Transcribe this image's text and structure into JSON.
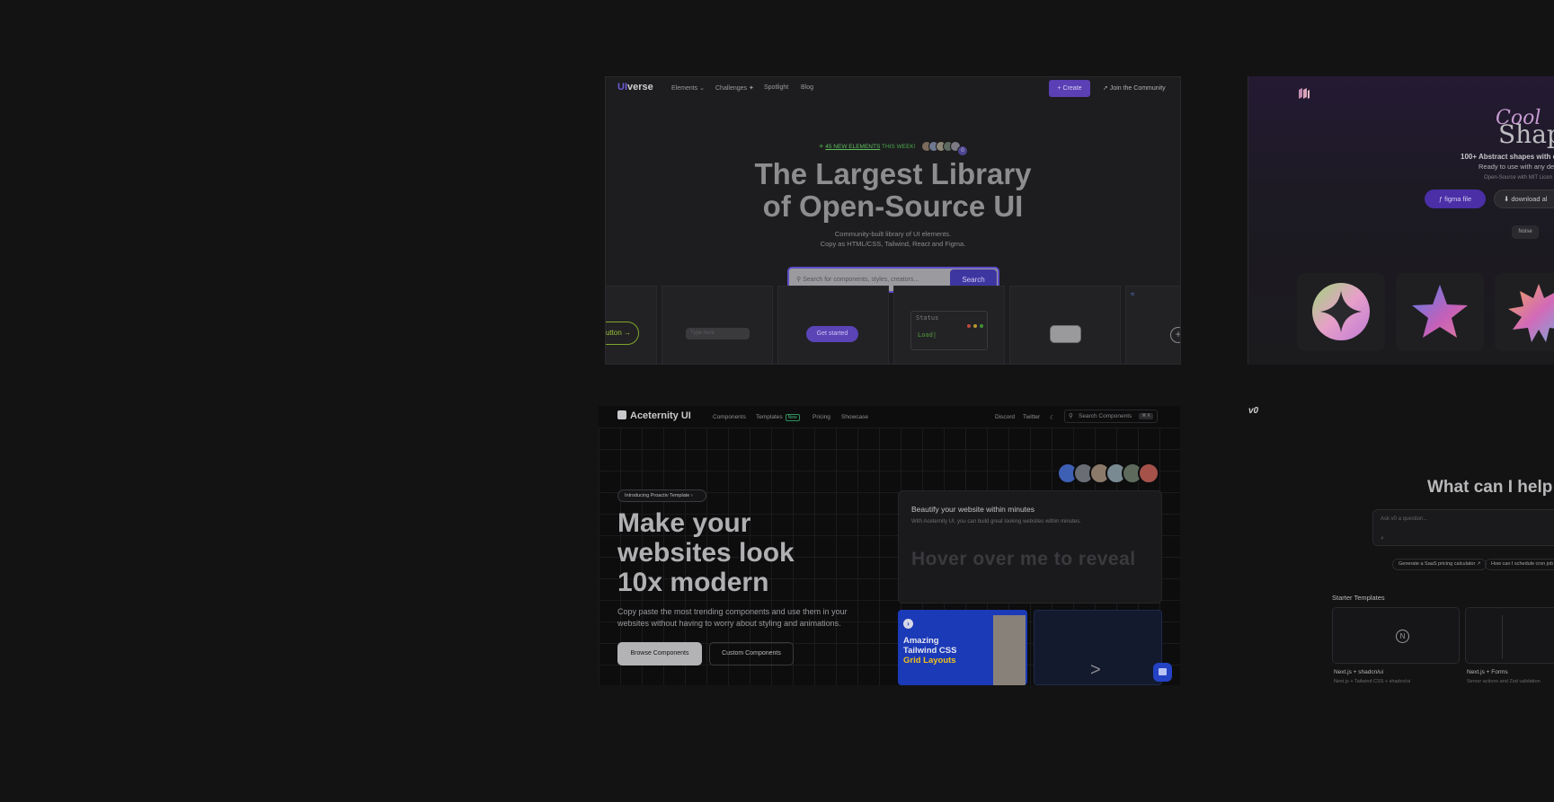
{
  "uiverse": {
    "logo_ui": "UI",
    "logo_verse": "verse",
    "nav": [
      "Elements",
      "Challenges",
      "Spotlight",
      "Blog"
    ],
    "nav_elements": "Elements ⌄",
    "nav_challenges": "Challenges ✦",
    "nav_spotlight": "Spotlight",
    "nav_blog": "Blog",
    "create": "+  Create",
    "join": "Join the Community",
    "new_count": "45 NEW ELEMENTS",
    "new_suffix": " THIS WEEK!",
    "avatar_badge": "0",
    "title_line1": "The Largest Library",
    "title_line2": "of Open-Source UI",
    "sub_line1": "Community-built library of UI elements.",
    "sub_line2": "Copy as HTML/CSS, Tailwind, React and Figma.",
    "search_placeholder": "Search for components, styles, creators...",
    "search_button": "Search",
    "tile_button": "utton  →",
    "tile_input": "Type here",
    "tile_get_started": "Get started",
    "tile_terminal_title": "Status",
    "tile_terminal_text": "Load|",
    "tile_plus": "+"
  },
  "shapes": {
    "cool": "Cool",
    "shapes": "Shap",
    "line1": "100+ Abstract shapes with co",
    "line2": "Ready to use with any des",
    "line3": "Open-Source with MIT Licen",
    "figma_button": "figma file",
    "download_button": "download al",
    "noise_tab": "Noise"
  },
  "aceternity": {
    "logo": "Aceternity UI",
    "nav_components": "Components",
    "nav_templates": "Templates",
    "nav_new_badge": "New",
    "nav_pricing": "Pricing",
    "nav_showcase": "Showcase",
    "nav_discord": "Discord",
    "nav_twitter": "Twitter",
    "search": "Search Components",
    "search_kbd": "⌘ K",
    "intro": "Introducing Proactiv Template",
    "hero_line1": "Make your",
    "hero_line2": "websites look",
    "hero_line3": "10x modern",
    "desc": "Copy paste the most trending components and use them in your websites without having to worry about styling and animations.",
    "browse": "Browse Components",
    "custom": "Custom Components",
    "panel_title": "Beautify your website within minutes",
    "panel_sub": "With Aceternity UI, you can build great looking websites within minutes.",
    "panel_reveal": "Hover over me to reveal",
    "blue_line1": "Amazing",
    "blue_line2": "Tailwind CSS",
    "blue_line3": "Grid Layouts",
    "map_arrow": ">"
  },
  "v0": {
    "logo": "v0",
    "heading": "What can I help",
    "ask_placeholder": "Ask v0 a question...",
    "chip1": "Generate a SaaS pricing calculator ↗",
    "chip2": "How can I schedule cron job",
    "starter": "Starter Templates",
    "tile1_label": "Next.js + shadcn/ui",
    "tile1_sub": "Next.js + Tailwind CSS + shadcn/ui",
    "tile2_label": "Next.js + Forms",
    "tile2_sub": "Server actions and Zod validation"
  },
  "colors": {
    "page_bg": "#131314",
    "uiverse_accent": "#5b3fb4",
    "aceternity_blue": "#1b3ab8"
  }
}
